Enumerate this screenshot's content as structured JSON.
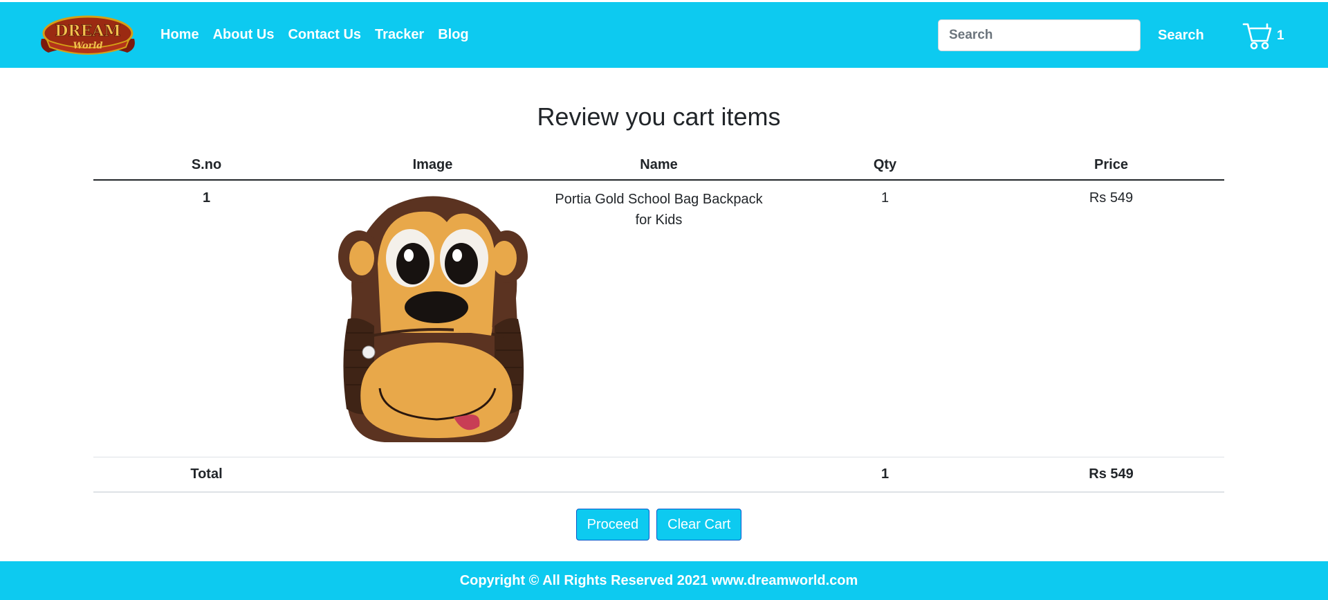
{
  "colors": {
    "accent": "#0dcaf0",
    "text": "#212529",
    "white": "#ffffff"
  },
  "brand": {
    "logo_word1": "DREAM",
    "logo_word2": "World"
  },
  "nav": {
    "links": [
      {
        "label": "Home"
      },
      {
        "label": "About Us"
      },
      {
        "label": "Contact Us"
      },
      {
        "label": "Tracker"
      },
      {
        "label": "Blog"
      }
    ],
    "search": {
      "placeholder": "Search",
      "button_label": "Search"
    },
    "cart": {
      "icon": "shopping-cart-icon",
      "count": "1"
    }
  },
  "page": {
    "heading": "Review you cart items"
  },
  "table": {
    "headers": [
      "S.no",
      "Image",
      "Name",
      "Qty",
      "Price"
    ],
    "rows": [
      {
        "sno": "1",
        "image": "monkey-backpack-image",
        "name": "Portia Gold School Bag Backpack for Kids",
        "qty": "1",
        "price": "Rs 549"
      }
    ],
    "total": {
      "label": "Total",
      "qty": "1",
      "price": "Rs 549"
    }
  },
  "actions": {
    "proceed_label": "Proceed",
    "clear_label": "Clear Cart"
  },
  "footer": {
    "text": "Copyright © All Rights Reserved 2021 www.dreamworld.com"
  }
}
